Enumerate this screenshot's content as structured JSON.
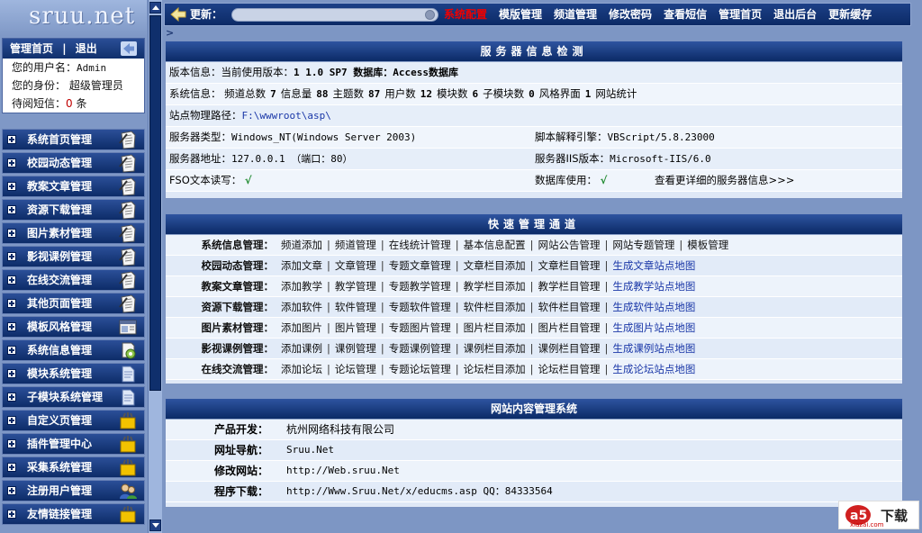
{
  "logo": "sruu.net",
  "userbox": {
    "home": "管理首页",
    "sep": "|",
    "logout": "退出",
    "rows": [
      {
        "label": "您的用户名：",
        "value": "Admin"
      },
      {
        "label": "您的身份：",
        "value": " 超级管理员"
      },
      {
        "label": "待阅短信：",
        "value": "0",
        "suffix": " 条"
      }
    ]
  },
  "menu": [
    {
      "label": "系统首页管理",
      "icon": "page-icon"
    },
    {
      "label": "校园动态管理",
      "icon": "page-icon"
    },
    {
      "label": "教案文章管理",
      "icon": "page-icon"
    },
    {
      "label": "资源下载管理",
      "icon": "page-icon"
    },
    {
      "label": "图片素材管理",
      "icon": "page-icon"
    },
    {
      "label": "影视课例管理",
      "icon": "page-icon"
    },
    {
      "label": "在线交流管理",
      "icon": "page-icon"
    },
    {
      "label": "其他页面管理",
      "icon": "page-icon"
    },
    {
      "label": "模板风格管理",
      "icon": "window-icon"
    },
    {
      "label": "系统信息管理",
      "icon": "gear-page-icon"
    },
    {
      "label": "模块系统管理",
      "icon": "document-icon"
    },
    {
      "label": "子模块系统管理",
      "icon": "document-icon"
    },
    {
      "label": "自定义页管理",
      "icon": "tools-icon"
    },
    {
      "label": "插件管理中心",
      "icon": "tools-icon"
    },
    {
      "label": "采集系统管理",
      "icon": "tools-icon"
    },
    {
      "label": "注册用户管理",
      "icon": "users-icon"
    },
    {
      "label": "友情链接管理",
      "icon": "tools-icon"
    }
  ],
  "topbar": {
    "update_label": "更新：",
    "nav": [
      "系统配置",
      "模版管理",
      "频道管理",
      "修改密码",
      "查看短信",
      "管理首页",
      "退出后台",
      "更新缓存"
    ]
  },
  "sub_marker": ">",
  "server": {
    "title": "服务器信息检测",
    "version_label": "版本信息：当前使用版本：",
    "version_value": "1 1.0 SP7 数据库：Access数据库",
    "stats_label": "系统信息：",
    "stats": [
      {
        "k": "频道总数",
        "v": "7"
      },
      {
        "k": "信息量",
        "v": "88"
      },
      {
        "k": "主题数",
        "v": "87"
      },
      {
        "k": "用户数",
        "v": "12"
      },
      {
        "k": "模块数",
        "v": "6"
      },
      {
        "k": "子模块数",
        "v": "0"
      },
      {
        "k": "风格界面",
        "v": "1"
      }
    ],
    "stats_tail": "网站统计",
    "path_label": "站点物理路径：",
    "path_value": "F:\\wwwroot\\asp\\",
    "os_label": "服务器类型：",
    "os_value": "Windows_NT(Windows Server 2003)",
    "script_label": "脚本解释引擎：",
    "script_value": "VBScript/5.8.23000",
    "addr_label": "服务器地址：",
    "addr_value": "127.0.0.1 （端口：80）",
    "iis_label": "服务器IIS版本：",
    "iis_value": "Microsoft-IIS/6.0",
    "fso_label": "FSO文本读写：",
    "fso_value": "√",
    "db_label": "数据库使用：",
    "db_value": "√",
    "more": "查看更详细的服务器信息>>>"
  },
  "quick": {
    "title": "快速管理通道",
    "rows": [
      {
        "label": "系统信息管理：",
        "links": [
          {
            "t": "频道添加"
          },
          {
            "t": "频道管理"
          },
          {
            "t": "在线统计管理"
          },
          {
            "t": "基本信息配置"
          },
          {
            "t": "网站公告管理"
          },
          {
            "t": "网站专题管理"
          },
          {
            "t": "模板管理"
          }
        ]
      },
      {
        "label": "校园动态管理：",
        "links": [
          {
            "t": "添加文章"
          },
          {
            "t": "文章管理"
          },
          {
            "t": "专题文章管理"
          },
          {
            "t": "文章栏目添加"
          },
          {
            "t": "文章栏目管理"
          },
          {
            "t": "生成文章站点地图",
            "blue": true
          }
        ]
      },
      {
        "label": "教案文章管理：",
        "links": [
          {
            "t": "添加教学"
          },
          {
            "t": "教学管理"
          },
          {
            "t": "专题教学管理"
          },
          {
            "t": "教学栏目添加"
          },
          {
            "t": "教学栏目管理"
          },
          {
            "t": "生成教学站点地图",
            "blue": true
          }
        ]
      },
      {
        "label": "资源下载管理：",
        "links": [
          {
            "t": "添加软件"
          },
          {
            "t": "软件管理"
          },
          {
            "t": "专题软件管理"
          },
          {
            "t": "软件栏目添加"
          },
          {
            "t": "软件栏目管理"
          },
          {
            "t": "生成软件站点地图",
            "blue": true
          }
        ]
      },
      {
        "label": "图片素材管理：",
        "links": [
          {
            "t": "添加图片"
          },
          {
            "t": "图片管理"
          },
          {
            "t": "专题图片管理"
          },
          {
            "t": "图片栏目添加"
          },
          {
            "t": "图片栏目管理"
          },
          {
            "t": "生成图片站点地图",
            "blue": true
          }
        ]
      },
      {
        "label": "影视课例管理：",
        "links": [
          {
            "t": "添加课例"
          },
          {
            "t": "课例管理"
          },
          {
            "t": "专题课例管理"
          },
          {
            "t": "课例栏目添加"
          },
          {
            "t": "课例栏目管理"
          },
          {
            "t": "生成课例站点地图",
            "blue": true
          }
        ]
      },
      {
        "label": "在线交流管理：",
        "links": [
          {
            "t": "添加论坛"
          },
          {
            "t": "论坛管理"
          },
          {
            "t": "专题论坛管理"
          },
          {
            "t": "论坛栏目添加"
          },
          {
            "t": "论坛栏目管理"
          },
          {
            "t": "生成论坛站点地图",
            "blue": true
          }
        ]
      }
    ]
  },
  "cms": {
    "title": "网站内容管理系统",
    "rows": [
      {
        "k": "产品开发：",
        "v": "杭州网络科技有限公司"
      },
      {
        "k": "网址导航：",
        "v": "Sruu.Net"
      },
      {
        "k": "修改网站：",
        "v": "http://Web.sruu.Net"
      },
      {
        "k": "程序下载：",
        "v": "http://Www.Sruu.Net/x/educms.asp QQ：84333564"
      }
    ]
  },
  "watermark": {
    "brand": "a5",
    "text": "下载",
    "site": "xiazai.com"
  }
}
